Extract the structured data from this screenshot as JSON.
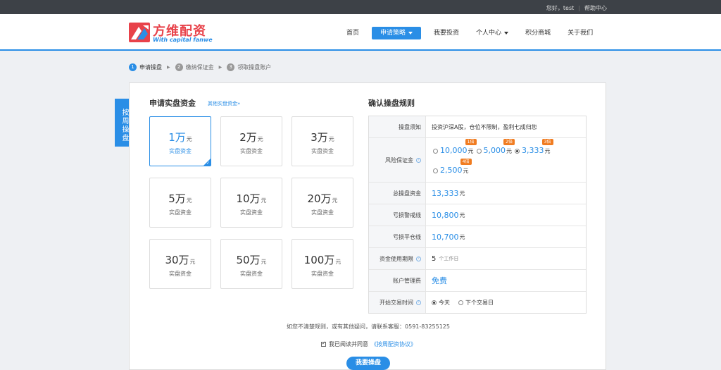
{
  "topbar": {
    "greeting": "您好，test",
    "help": "帮助中心"
  },
  "logo": {
    "cn": "方维配资",
    "en": "With capital fanwe"
  },
  "nav": [
    {
      "label": "首页",
      "active": false,
      "dropdown": false
    },
    {
      "label": "申请策略",
      "active": true,
      "dropdown": true
    },
    {
      "label": "我要投资",
      "active": false,
      "dropdown": false
    },
    {
      "label": "个人中心",
      "active": false,
      "dropdown": true
    },
    {
      "label": "积分商城",
      "active": false,
      "dropdown": false
    },
    {
      "label": "关于我们",
      "active": false,
      "dropdown": false
    }
  ],
  "steps": [
    {
      "num": "1",
      "label": "申请操盘"
    },
    {
      "num": "2",
      "label": "缴纳保证金"
    },
    {
      "num": "3",
      "label": "领取操盘账户"
    }
  ],
  "side_tab": "按周操盘",
  "left": {
    "title": "申请实盘资金",
    "more": "其他实盘资金»",
    "unit": "元",
    "sub": "实盘资金",
    "cards": [
      {
        "amount": "1万",
        "selected": true
      },
      {
        "amount": "2万",
        "selected": false
      },
      {
        "amount": "3万",
        "selected": false
      },
      {
        "amount": "5万",
        "selected": false
      },
      {
        "amount": "10万",
        "selected": false
      },
      {
        "amount": "20万",
        "selected": false
      },
      {
        "amount": "30万",
        "selected": false
      },
      {
        "amount": "50万",
        "selected": false
      },
      {
        "amount": "100万",
        "selected": false
      }
    ]
  },
  "right": {
    "title": "确认操盘规则",
    "notice_label": "操盘须知",
    "notice_value": "投资沪深A股，仓位不限制，盈利七成归您",
    "risk_label": "风险保证金",
    "risk_options": [
      {
        "value": "10,000",
        "unit": "元",
        "badge": "1倍",
        "selected": false
      },
      {
        "value": "5,000",
        "unit": "元",
        "badge": "2倍",
        "selected": false
      },
      {
        "value": "3,333",
        "unit": "元",
        "badge": "3倍",
        "selected": true
      },
      {
        "value": "2,500",
        "unit": "元",
        "badge": "4倍",
        "selected": false
      }
    ],
    "total_label": "总操盘资金",
    "total_value": "13,333",
    "warn_label": "亏损警戒线",
    "warn_value": "10,800",
    "close_label": "亏损平仓线",
    "close_value": "10,700",
    "period_label": "资金使用期限",
    "period_value": "5",
    "period_unit": "个工作日",
    "fee_label": "账户管理费",
    "fee_value": "免费",
    "start_label": "开始交易时间",
    "start_today": "今天",
    "start_next": "下个交易日",
    "yuan": "元"
  },
  "footer": {
    "note": "如您不清楚规则，或有其他疑问，请联系客服：0591-83255125",
    "agree_text": "我已阅读并同意",
    "agree_link": "《按周配资协议》",
    "submit": "我要操盘"
  },
  "colors": {
    "accent": "#2a8ee6",
    "badge": "#f07c21",
    "logo_red": "#e8424a"
  }
}
